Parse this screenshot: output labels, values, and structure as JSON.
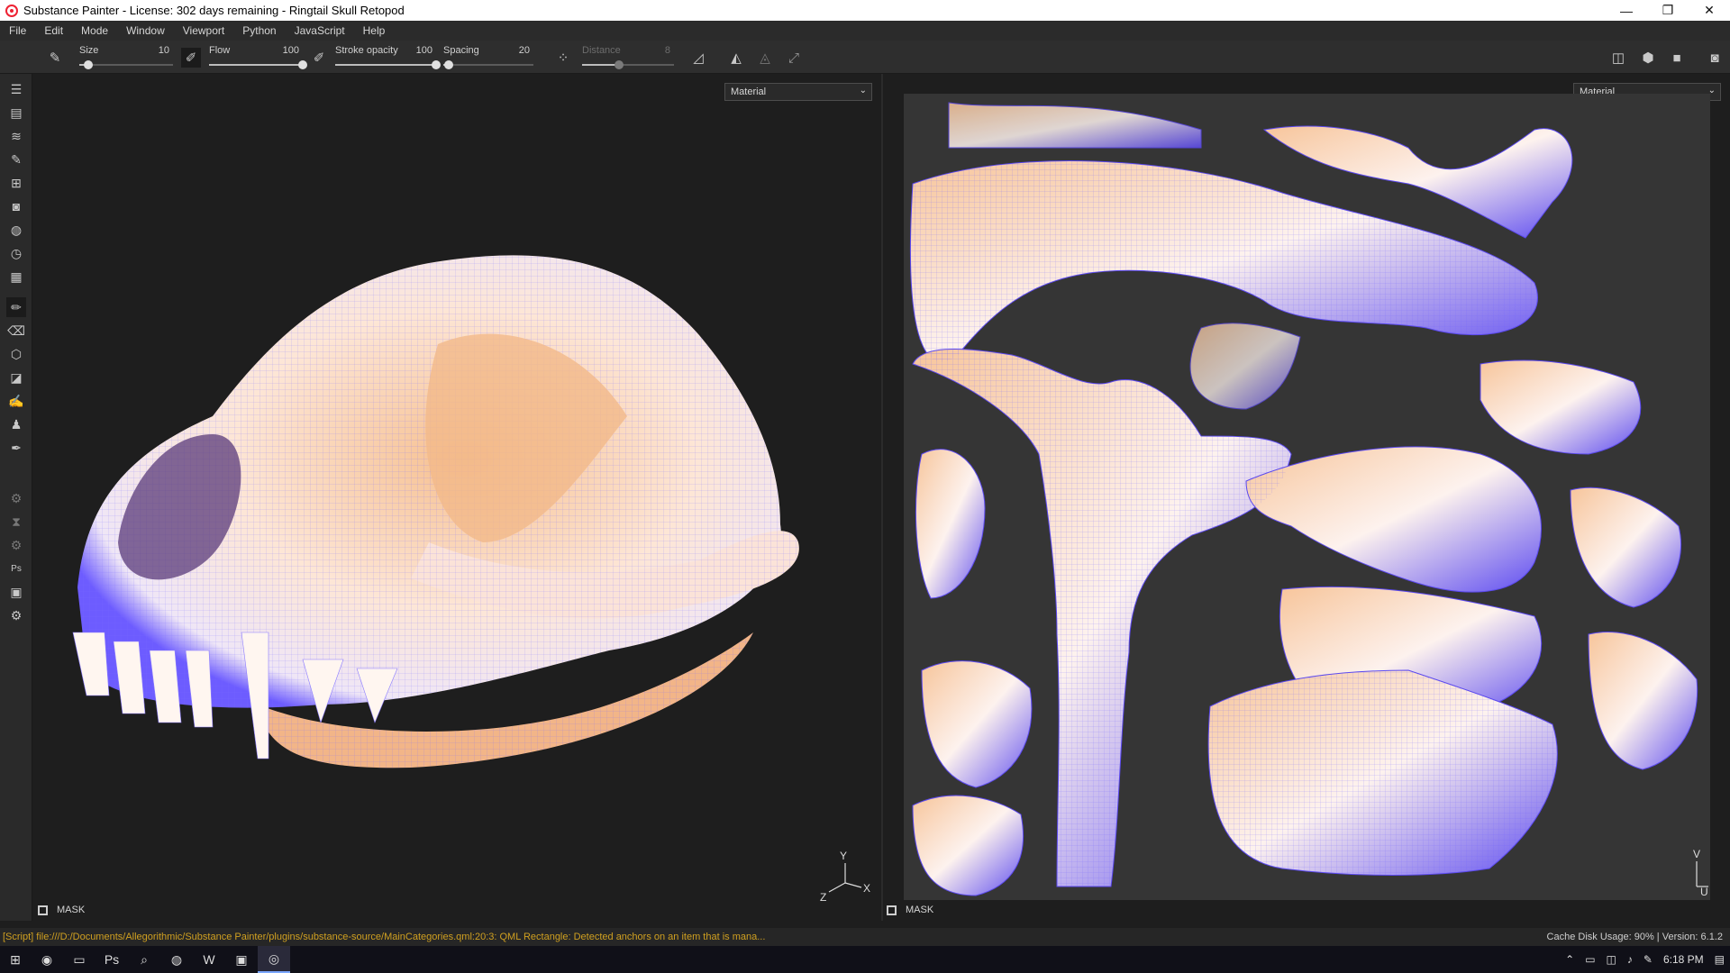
{
  "window": {
    "title": "Substance Painter - License: 302 days remaining - Ringtail Skull Retopod",
    "minimize": "—",
    "maximize": "❐",
    "close": "✕"
  },
  "menu": [
    "File",
    "Edit",
    "Mode",
    "Window",
    "Viewport",
    "Python",
    "JavaScript",
    "Help"
  ],
  "toolbar": {
    "size": {
      "label": "Size",
      "value": "10",
      "level": 0.1
    },
    "flow": {
      "label": "Flow",
      "value": "100",
      "level": 1.0
    },
    "stroke_opacity": {
      "label": "Stroke opacity",
      "value": "100",
      "level": 1.0
    },
    "spacing": {
      "label": "Spacing",
      "value": "20",
      "level": 0.06
    },
    "distance": {
      "label": "Distance",
      "value": "8",
      "level": 0.4
    }
  },
  "viewport3d": {
    "mode": "Material",
    "mask_label": "MASK",
    "axes": {
      "x": "X",
      "y": "Y",
      "z": "Z"
    }
  },
  "viewport2d": {
    "mode": "Material",
    "mask_label": "MASK",
    "axes": {
      "u": "U",
      "v": "V"
    }
  },
  "status": {
    "message": "[Script] file:///D:/Documents/Allegorithmic/Substance Painter/plugins/substance-source/MainCategories.qml:20:3: QML Rectangle: Detected anchors on an item that is mana...",
    "cache": "Cache Disk Usage:  90% | Version: 6.1.2"
  },
  "taskbar": {
    "clock": "6:18 PM"
  },
  "colors": {
    "accent": "#d0a020",
    "mesh_light": "#fff4ee",
    "mesh_warm": "#f2b27a",
    "mesh_wire": "#5a4bff"
  }
}
